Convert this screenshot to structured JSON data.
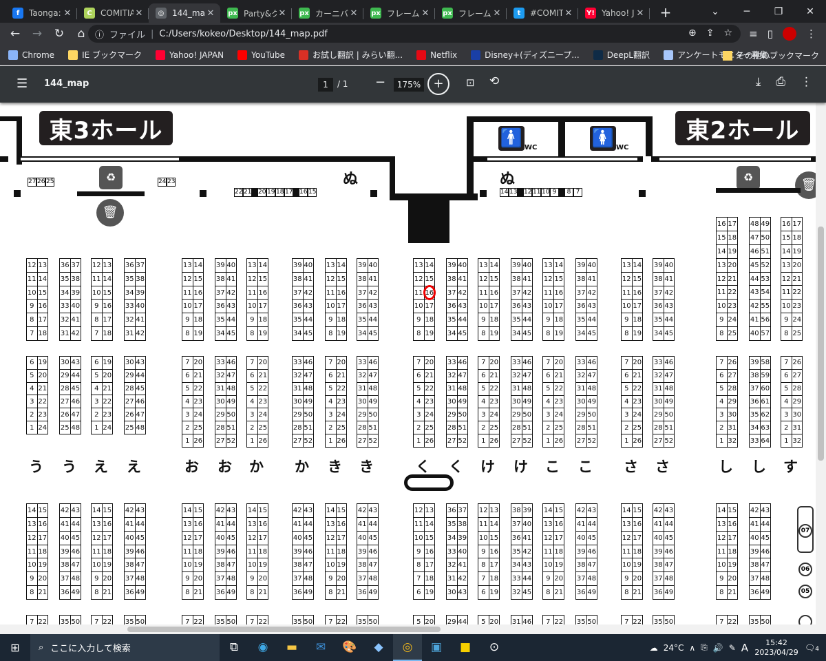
{
  "tabs": [
    {
      "label": "Taonga: The",
      "color": "#1877f2",
      "glyph": "f"
    },
    {
      "label": "COMITIA",
      "color": "#aed35c",
      "glyph": "C"
    },
    {
      "label": "144_map",
      "color": "#5f6368",
      "glyph": "◎",
      "active": true
    },
    {
      "label": "Party&ク",
      "color": "#3fb950",
      "glyph": "px"
    },
    {
      "label": "カーニバル",
      "color": "#3fb950",
      "glyph": "px"
    },
    {
      "label": "フレーム 総",
      "color": "#3fb950",
      "glyph": "px"
    },
    {
      "label": "フレーム&",
      "color": "#3fb950",
      "glyph": "px"
    },
    {
      "label": "#COMITI",
      "color": "#1d9bf0",
      "glyph": "t"
    },
    {
      "label": "Yahoo! Ja",
      "color": "#ff0033",
      "glyph": "Y!"
    }
  ],
  "omnibox": {
    "label": "ファイル",
    "url": "C:/Users/kokeo/Desktop/144_map.pdf"
  },
  "bookmarks": [
    {
      "label": "Chrome",
      "color": "#8ab4f8"
    },
    {
      "label": "IE ブックマーク",
      "color": "#fdd663"
    },
    {
      "label": "Yahoo! JAPAN",
      "color": "#ff0033"
    },
    {
      "label": "YouTube",
      "color": "#ff0000"
    },
    {
      "label": "お試し翻訳 | みらい翻...",
      "color": "#d93025"
    },
    {
      "label": "Netflix",
      "color": "#e50914"
    },
    {
      "label": "Disney+(ディズニープ...",
      "color": "#1a3fa6"
    },
    {
      "label": "DeepL翻訳",
      "color": "#0f2b46"
    },
    {
      "label": "アンケートモニター募集...",
      "color": "#a8c7fa"
    }
  ],
  "bookmarks_other": "その他のブックマーク",
  "pdf": {
    "filename": "144_map",
    "page": "1",
    "page_total": "/   1",
    "zoom": "175%"
  },
  "map": {
    "hall_left": "東3ホール",
    "hall_right": "東2ホール",
    "wc": "WC",
    "top_label_left": "ぬ",
    "top_label_right": "ぬ",
    "wall_left_a": [
      "27",
      "26",
      "25"
    ],
    "wall_left_b": [
      "24",
      "23"
    ],
    "wall_mid": [
      "22",
      "21",
      "|",
      "20",
      "19",
      "18",
      "17",
      "|",
      "16",
      "15"
    ],
    "wall_right": [
      "14",
      "13",
      "|",
      "12",
      "11",
      "10",
      "9",
      "|",
      "8",
      "7"
    ],
    "row_labels": [
      "う",
      "う",
      "え",
      "え",
      "お",
      "お",
      "か",
      "か",
      "き",
      "き",
      "く",
      "く",
      "け",
      "け",
      "こ",
      "こ",
      "さ",
      "さ",
      "し",
      "し",
      "す"
    ],
    "page_badges": [
      "07",
      "06",
      "05"
    ],
    "booths_row1": [
      [
        "12 13",
        "11 14",
        "10 15",
        "9 16",
        "8 17",
        "7 18"
      ],
      [
        "36 37",
        "35 38",
        "34 39",
        "33 40",
        "32 41",
        "31 42"
      ],
      [
        "12 13",
        "11 14",
        "10 15",
        "9 16",
        "8 17",
        "7 18"
      ],
      [
        "36 37",
        "35 38",
        "34 39",
        "33 40",
        "32 41",
        "31 42"
      ],
      [
        "13 14",
        "12 15",
        "11 16",
        "10 17",
        "9 18",
        "8 19"
      ],
      [
        "39 40",
        "38 41",
        "37 42",
        "36 43",
        "35 44",
        "34 45"
      ],
      [
        "13 14",
        "12 15",
        "11 16",
        "10 17",
        "9 18",
        "8 19"
      ],
      [
        "39 40",
        "38 41",
        "37 42",
        "36 43",
        "35 44",
        "34 45"
      ],
      [
        "13 14",
        "12 15",
        "11 16",
        "10 17",
        "9 18",
        "8 19"
      ],
      [
        "39 40",
        "38 41",
        "37 42",
        "36 43",
        "35 44",
        "34 45"
      ],
      [
        "13 14",
        "12 15",
        "11 16",
        "10 17",
        "9 18",
        "8 19"
      ],
      [
        "39 40",
        "38 41",
        "37 42",
        "36 43",
        "35 44",
        "34 45"
      ],
      [
        "13 14",
        "12 15",
        "11 16",
        "10 17",
        "9 18",
        "8 19"
      ],
      [
        "39 40",
        "38 41",
        "37 42",
        "36 43",
        "35 44",
        "34 45"
      ],
      [
        "13 14",
        "12 15",
        "11 16",
        "10 17",
        "9 18",
        "8 19"
      ],
      [
        "39 40",
        "38 41",
        "37 42",
        "36 43",
        "35 44",
        "34 45"
      ],
      [
        "13 14",
        "12 15",
        "11 16",
        "10 17",
        "9 18",
        "8 19"
      ],
      [
        "39 40",
        "38 41",
        "37 42",
        "36 43",
        "35 44",
        "34 45"
      ],
      [
        "16 17",
        "15 18",
        "14 19",
        "13 20",
        "12 21",
        "11 22",
        "10 23",
        "9 24",
        "8 25"
      ],
      [
        "48 49",
        "47 50",
        "46 51",
        "45 52",
        "44 53",
        "43 54",
        "42 55",
        "41 56",
        "40 57"
      ],
      [
        "16 17",
        "15 18",
        "14 19",
        "13 20",
        "12 21",
        "11 22",
        "10 23",
        "9 24",
        "8 25"
      ]
    ],
    "booths_row2": [
      [
        "6 19",
        "5 20",
        "4 21",
        "3 22",
        "2 23",
        "1 24"
      ],
      [
        "30 43",
        "29 44",
        "28 45",
        "27 46",
        "26 47",
        "25 48"
      ],
      [
        "6 19",
        "5 20",
        "4 21",
        "3 22",
        "2 23",
        "1 24"
      ],
      [
        "30 43",
        "29 44",
        "28 45",
        "27 46",
        "26 47",
        "25 48"
      ],
      [
        "7 20",
        "6 21",
        "5 22",
        "4 23",
        "3 24",
        "2 25",
        "1 26"
      ],
      [
        "33 46",
        "32 47",
        "31 48",
        "30 49",
        "29 50",
        "28 51",
        "27 52"
      ],
      [
        "7 20",
        "6 21",
        "5 22",
        "4 23",
        "3 24",
        "2 25",
        "1 26"
      ],
      [
        "33 46",
        "32 47",
        "31 48",
        "30 49",
        "29 50",
        "28 51",
        "27 52"
      ],
      [
        "7 20",
        "6 21",
        "5 22",
        "4 23",
        "3 24",
        "2 25",
        "1 26"
      ],
      [
        "33 46",
        "32 47",
        "31 48",
        "30 49",
        "29 50",
        "28 51",
        "27 52"
      ],
      [
        "7 20",
        "6 21",
        "5 22",
        "4 23",
        "3 24",
        "2 25",
        "1 26"
      ],
      [
        "33 46",
        "32 47",
        "31 48",
        "30 49",
        "29 50",
        "28 51",
        "27 52"
      ],
      [
        "7 20",
        "6 21",
        "5 22",
        "4 23",
        "3 24",
        "2 25",
        "1 26"
      ],
      [
        "33 46",
        "32 47",
        "31 48",
        "30 49",
        "29 50",
        "28 51",
        "27 52"
      ],
      [
        "7 20",
        "6 21",
        "5 22",
        "4 23",
        "3 24",
        "2 25",
        "1 26"
      ],
      [
        "33 46",
        "32 47",
        "31 48",
        "30 49",
        "29 50",
        "28 51",
        "27 52"
      ],
      [
        "7 20",
        "6 21",
        "5 22",
        "4 23",
        "3 24",
        "2 25",
        "1 26"
      ],
      [
        "33 46",
        "32 47",
        "31 48",
        "30 49",
        "29 50",
        "28 51",
        "27 52"
      ],
      [
        "7 26",
        "6 27",
        "5 28",
        "4 29",
        "3 30",
        "2 31",
        "1 32"
      ],
      [
        "39 58",
        "38 59",
        "37 60",
        "36 61",
        "35 62",
        "34 63",
        "33 64"
      ],
      [
        "7 26",
        "6 27",
        "5 28",
        "4 29",
        "3 30",
        "2 31",
        "1 32"
      ]
    ],
    "booths_row3": [
      [
        "14 15",
        "13 16",
        "12 17",
        "11 18",
        "10 19",
        "9 20",
        "8 21"
      ],
      [
        "42 43",
        "41 44",
        "40 45",
        "39 46",
        "38 47",
        "37 48",
        "36 49"
      ],
      [
        "14 15",
        "13 16",
        "12 17",
        "11 18",
        "10 19",
        "9 20",
        "8 21"
      ],
      [
        "42 43",
        "41 44",
        "40 45",
        "39 46",
        "38 47",
        "37 48",
        "36 49"
      ],
      [
        "14 15",
        "13 16",
        "12 17",
        "11 18",
        "10 19",
        "9 20",
        "8 21"
      ],
      [
        "42 43",
        "41 44",
        "40 45",
        "39 46",
        "38 47",
        "37 48",
        "36 49"
      ],
      [
        "14 15",
        "13 16",
        "12 17",
        "11 18",
        "10 19",
        "9 20",
        "8 21"
      ],
      [
        "42 43",
        "41 44",
        "40 45",
        "39 46",
        "38 47",
        "37 48",
        "36 49"
      ],
      [
        "14 15",
        "13 16",
        "12 17",
        "11 18",
        "10 19",
        "9 20",
        "8 21"
      ],
      [
        "42 43",
        "41 44",
        "40 45",
        "39 46",
        "38 47",
        "37 48",
        "36 49"
      ],
      [
        "12 13",
        "11 14",
        "10 15",
        "9 16",
        "8 17",
        "7 18",
        "6 19"
      ],
      [
        "36 37",
        "35 38",
        "34 39",
        "33 40",
        "32 41",
        "31 42",
        "30 43"
      ],
      [
        "12 13",
        "11 14",
        "10 15",
        "9 16",
        "8 17",
        "7 18",
        "6 19"
      ],
      [
        "38 39",
        "37 40",
        "36 41",
        "35 42",
        "34 43",
        "33 44",
        "32 45"
      ],
      [
        "14 15",
        "13 16",
        "12 17",
        "11 18",
        "10 19",
        "9 20",
        "8 21"
      ],
      [
        "42 43",
        "41 44",
        "40 45",
        "39 46",
        "38 47",
        "37 48",
        "36 49"
      ],
      [
        "14 15",
        "13 16",
        "12 17",
        "11 18",
        "10 19",
        "9 20",
        "8 21"
      ],
      [
        "42 43",
        "41 44",
        "40 45",
        "39 46",
        "38 47",
        "37 48",
        "36 49"
      ],
      [
        "14 15",
        "13 16",
        "12 17",
        "11 18",
        "10 19",
        "9 20",
        "8 21"
      ],
      [
        "42 43",
        "41 44",
        "40 45",
        "39 46",
        "38 47",
        "37 48",
        "36 49"
      ]
    ],
    "booths_row4": [
      [
        "7 22"
      ],
      [
        "35 50"
      ],
      [
        "7 22"
      ],
      [
        "35 50"
      ],
      [
        "7 22"
      ],
      [
        "35 50"
      ],
      [
        "7 22"
      ],
      [
        "35 50"
      ],
      [
        "7 22"
      ],
      [
        "35 50"
      ],
      [
        "5 20"
      ],
      [
        "29 44"
      ],
      [
        "5 20"
      ],
      [
        "31 46"
      ],
      [
        "7 22"
      ],
      [
        "35 50"
      ],
      [
        "7 22"
      ],
      [
        "35 50"
      ],
      [
        "7 22"
      ],
      [
        "35 50"
      ]
    ]
  },
  "taskbar": {
    "search_placeholder": "ここに入力して検索",
    "temperature": "24°C",
    "time": "15:42",
    "date": "2023/04/29",
    "notifications": "4",
    "ime": "A"
  }
}
